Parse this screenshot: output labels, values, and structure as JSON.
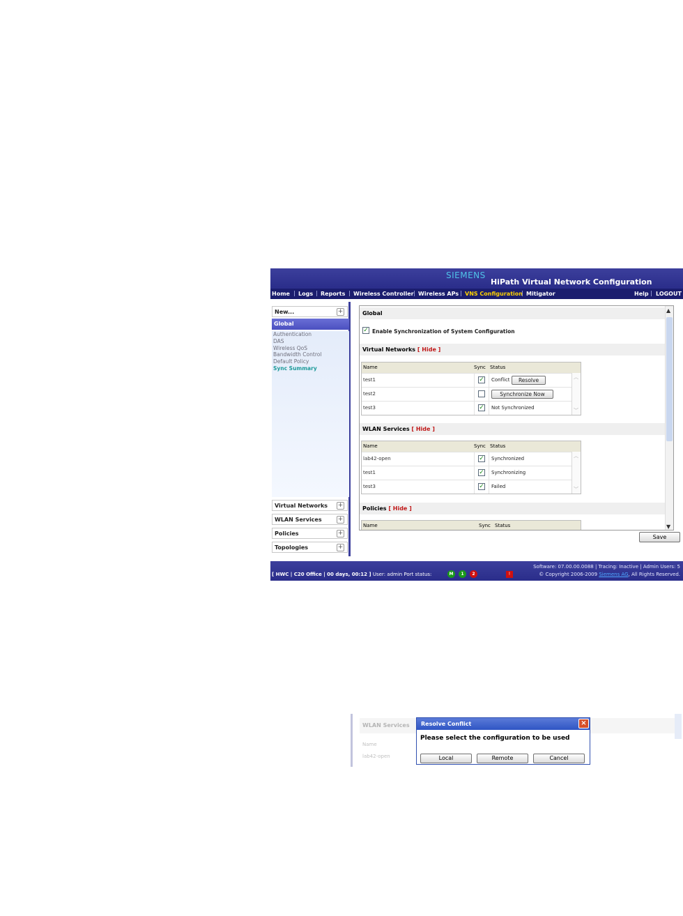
{
  "header": {
    "brand": "SIEMENS",
    "title": "HiPath Virtual Network Configuration"
  },
  "nav": {
    "items": [
      "Home",
      "Logs",
      "Reports",
      "Wireless Controller",
      "Wireless APs",
      "VNS Configuration",
      "Mitigator"
    ],
    "active": "VNS Configuration",
    "right": [
      "Help",
      "LOGOUT"
    ]
  },
  "sidebar": {
    "new_label": "New...",
    "global_label": "Global",
    "links": [
      "Authentication",
      "DAS",
      "Wireless QoS",
      "Bandwidth Control",
      "Default Policy",
      "Sync Summary"
    ],
    "current_link": "Sync Summary",
    "sections": [
      "Virtual Networks",
      "WLAN Services",
      "Policies",
      "Topologies"
    ]
  },
  "content": {
    "global_title": "Global",
    "sync_checkbox_label": "Enable Synchronization of System Configuration",
    "hide_label": "[ Hide ]",
    "columns": {
      "name": "Name",
      "sync": "Sync",
      "status": "Status"
    },
    "virtual_networks": {
      "title": "Virtual Networks",
      "rows": [
        {
          "name": "test1",
          "sync": true,
          "status": "Conflict",
          "button": "Resolve"
        },
        {
          "name": "test2",
          "sync": false,
          "status": "",
          "button": "Synchronize Now"
        },
        {
          "name": "test3",
          "sync": true,
          "status": "Not Synchronized"
        }
      ]
    },
    "wlan_services": {
      "title": "WLAN Services",
      "rows": [
        {
          "name": "lab42-open",
          "sync": true,
          "status": "Synchronized"
        },
        {
          "name": "test1",
          "sync": true,
          "status": "Synchronizing"
        },
        {
          "name": "test3",
          "sync": true,
          "status": "Failed"
        }
      ]
    },
    "policies": {
      "title": "Policies"
    },
    "save_label": "Save"
  },
  "footer": {
    "left_bold": "[ HWC | C20 Office | 00 days, 00:12 ]",
    "left_rest": "User: admin  Port status:",
    "ports": [
      {
        "label": "M",
        "color": "#1a9a1a"
      },
      {
        "label": "1",
        "color": "#1a9a1a"
      },
      {
        "label": "2",
        "color": "#d01010"
      }
    ],
    "alarm_label": "!",
    "software": "Software: 07.00.00.0088 | Tracing: Inactive | Admin Users: 5",
    "copyright": "© Copyright  2006-2009",
    "copyright_link": "Siemens AG",
    "rights": ", All Rights Reserved."
  },
  "inset": {
    "bg_section": "WLAN Services",
    "bg_name": "Name",
    "bg_row": "lab42-open",
    "dialog": {
      "title": "Resolve Conflict",
      "message": "Please select the configuration to be used",
      "buttons": [
        "Local",
        "Remote",
        "Cancel"
      ]
    }
  }
}
